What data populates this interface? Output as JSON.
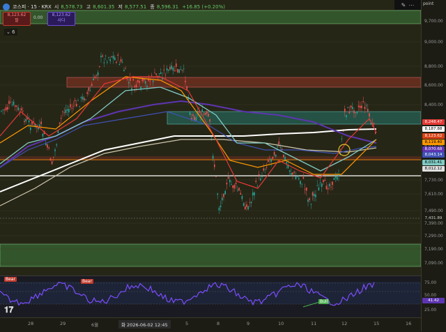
{
  "header": {
    "title": "코스피 · 15 · KRX",
    "open_label": "시",
    "open": "8,578.73",
    "high_label": "고",
    "high": "8,601.35",
    "low_label": "저",
    "low": "8,577.51",
    "close_label": "종",
    "close": "8,596.31",
    "change": "+16.85 (+0.20%)"
  },
  "trade": {
    "sell_price": "8,123.62",
    "sell_label": "팔",
    "spread": "0.00",
    "buy_price": "8,123.62",
    "buy_label": "사다"
  },
  "indicators_count": "6",
  "toolbar": {
    "right_label": "point"
  },
  "price_axis": {
    "ticks": [
      "9,700.00",
      "9,000.00",
      "8,800.00",
      "8,600.00",
      "8,400.00",
      "8,010.00",
      "7,730.00",
      "7,610.00",
      "7,490.00",
      "7,390.00",
      "7,290.00",
      "7,190.00",
      "7,090.00"
    ]
  },
  "price_tags": [
    {
      "label": "8,248.47",
      "bg": "#e53935",
      "fg": "#ffffff"
    },
    {
      "label": "8,187.88",
      "bg": "#ffffff",
      "fg": "#000000"
    },
    {
      "label": "8,123.62",
      "bg": "#d84315",
      "fg": "#ffffff"
    },
    {
      "label": "8,119.40",
      "bg": "#ff9800",
      "fg": "#000000"
    },
    {
      "label": "8,070.68",
      "bg": "#5e35b1",
      "fg": "#ffffff"
    },
    {
      "label": "8,043.14",
      "bg": "#3f51b5",
      "fg": "#ffffff"
    },
    {
      "label": "8,031.41",
      "bg": "#80cbc4",
      "fg": "#000000"
    },
    {
      "label": "8,012.12",
      "bg": "#e0e0e0",
      "fg": "#000000"
    },
    {
      "label": "7,431.89",
      "bg": "#1c1c14",
      "fg": "#d0d0d0"
    }
  ],
  "time_axis": {
    "labels": [
      "28",
      "29",
      "6월",
      "5",
      "8",
      "9",
      "10",
      "11",
      "12",
      "15",
      "16"
    ],
    "current": "화 2026-06-02   12:45"
  },
  "oscillator": {
    "levels": [
      "75.00",
      "50.00",
      "25.00"
    ],
    "value_top": "50.00",
    "value": "41.42",
    "bear_label": "Bear",
    "bull_label": "Bull"
  },
  "colors": {
    "green_zone": "#4caf50",
    "red_zone": "#c0392b",
    "teal_zone": "#26a69a",
    "candle_up": "#26a69a",
    "candle_down": "#ef5350"
  }
}
